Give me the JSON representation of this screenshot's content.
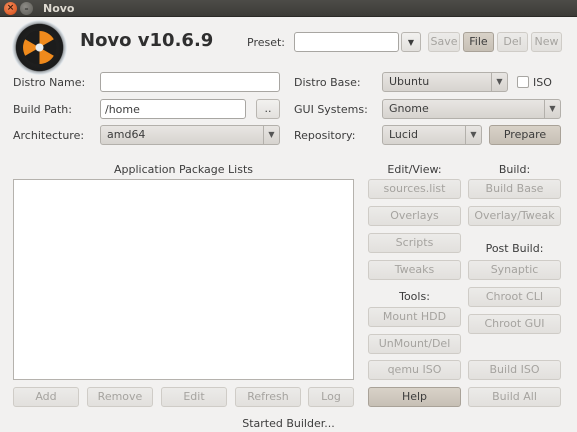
{
  "window": {
    "title": "Novo"
  },
  "app": {
    "title": "Novo v10.6.9"
  },
  "preset": {
    "label": "Preset:",
    "value": "",
    "save": "Save",
    "file": "File",
    "del": "Del",
    "new": "New"
  },
  "form": {
    "distro_name_label": "Distro Name:",
    "distro_name_value": "",
    "build_path_label": "Build Path:",
    "build_path_value": "/home",
    "browse": "..",
    "architecture_label": "Architecture:",
    "architecture_value": "amd64",
    "distro_base_label": "Distro Base:",
    "distro_base_value": "Ubuntu",
    "iso_label": "ISO",
    "gui_systems_label": "GUI Systems:",
    "gui_systems_value": "Gnome",
    "repository_label": "Repository:",
    "repository_value": "Lucid",
    "prepare": "Prepare"
  },
  "packages": {
    "title": "Application Package Lists",
    "add": "Add",
    "remove": "Remove",
    "edit": "Edit",
    "refresh": "Refresh",
    "log": "Log"
  },
  "editview": {
    "title": "Edit/View:",
    "sources": "sources.list",
    "overlays": "Overlays",
    "scripts": "Scripts",
    "tweaks": "Tweaks"
  },
  "build": {
    "title": "Build:",
    "build_base": "Build Base",
    "overlay_tweak": "Overlay/Tweak"
  },
  "postbuild": {
    "title": "Post Build:",
    "synaptic": "Synaptic",
    "chroot_cli": "Chroot CLI",
    "chroot_gui": "Chroot GUI",
    "build_iso": "Build ISO",
    "build_all": "Build All"
  },
  "tools": {
    "title": "Tools:",
    "mount_hdd": "Mount HDD",
    "unmount_del": "UnMount/Del",
    "qemu_iso": "qemu ISO",
    "help": "Help"
  },
  "status": "Started Builder..."
}
